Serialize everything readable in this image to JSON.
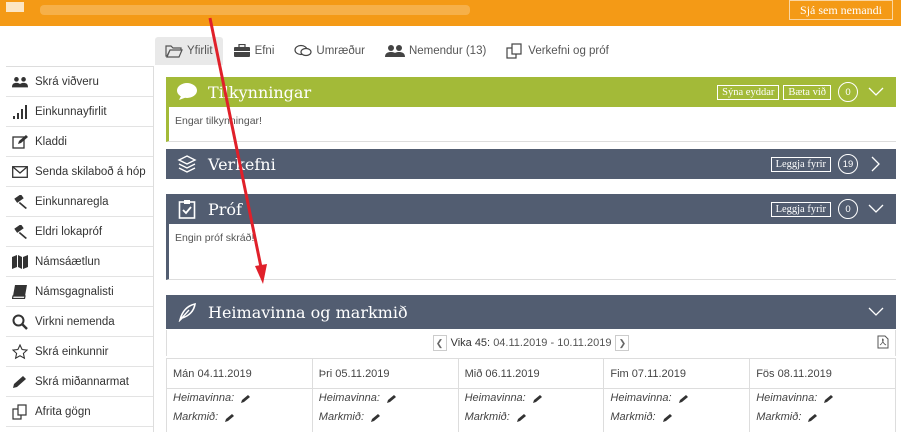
{
  "topbar": {
    "button_label": "Sjá sem nemandi",
    "accent": "#f49a16"
  },
  "tabs": [
    {
      "label": "Yfirlit",
      "icon": "folder-open-icon"
    },
    {
      "label": "Efni",
      "icon": "briefcase-icon"
    },
    {
      "label": "Umræður",
      "icon": "chat-icon"
    },
    {
      "label": "Nemendur (13)",
      "icon": "users-icon"
    },
    {
      "label": "Verkefni og próf",
      "icon": "copy-icon"
    }
  ],
  "sidebar": {
    "items": [
      {
        "label": "Skrá viðveru",
        "icon": "users-icon"
      },
      {
        "label": "Einkunnayfirlit",
        "icon": "bar-chart-icon"
      },
      {
        "label": "Kladdi",
        "icon": "edit-icon"
      },
      {
        "label": "Senda skilaboð á hóp",
        "icon": "envelope-icon"
      },
      {
        "label": "Einkunnaregla",
        "icon": "gavel-icon"
      },
      {
        "label": "Eldri lokapróf",
        "icon": "gavel-icon"
      },
      {
        "label": "Námsáætlun",
        "icon": "map-icon"
      },
      {
        "label": "Námsgagnalisti",
        "icon": "book-icon"
      },
      {
        "label": "Virkni nemenda",
        "icon": "search-icon"
      },
      {
        "label": "Skrá einkunnir",
        "icon": "star-icon"
      },
      {
        "label": "Skrá miðannarmat",
        "icon": "pencil-icon"
      },
      {
        "label": "Afrita gögn",
        "icon": "copy-icon"
      }
    ]
  },
  "panels": {
    "tilkynningar": {
      "title": "Tilkynningar",
      "btn_show_deleted": "Sýna eyddar",
      "btn_add": "Bæta við",
      "count": "0",
      "body": "Engar tilkynningar!",
      "color": "#a3ba38"
    },
    "verkefni": {
      "title": "Verkefni",
      "btn_assign": "Leggja fyrir",
      "count": "19",
      "color": "#525d71"
    },
    "prof": {
      "title": "Próf",
      "btn_assign": "Leggja fyrir",
      "count": "0",
      "body": "Engin próf skráð!"
    },
    "heimavinna": {
      "title": "Heimavinna og markmið"
    }
  },
  "week": {
    "label": "Vika 45:",
    "range": "04.11.2019 - 10.11.2019",
    "days": [
      {
        "name": "Mán 04.11.2019"
      },
      {
        "name": "Þri 05.11.2019"
      },
      {
        "name": "Mið 06.11.2019"
      },
      {
        "name": "Fim 07.11.2019"
      },
      {
        "name": "Fös 08.11.2019"
      }
    ],
    "homework_label": "Heimavinna:",
    "goal_label": "Markmið:"
  },
  "colors": {
    "slate": "#525d71",
    "green": "#a3ba38",
    "arrow": "#e0202a"
  }
}
